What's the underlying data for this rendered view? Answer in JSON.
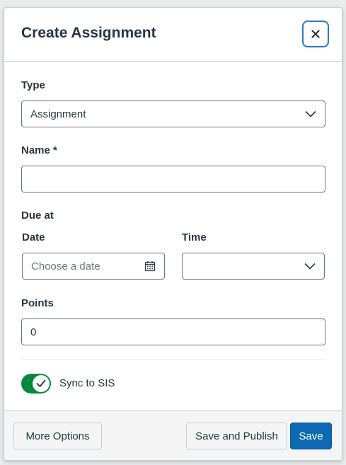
{
  "dialog": {
    "title": "Create Assignment",
    "close_icon": "close-icon"
  },
  "form": {
    "type": {
      "label": "Type",
      "value": "Assignment"
    },
    "name": {
      "label": "Name *",
      "value": ""
    },
    "due": {
      "section_label": "Due at",
      "date_label": "Date",
      "date_placeholder": "Choose a date",
      "time_label": "Time",
      "time_value": ""
    },
    "points": {
      "label": "Points",
      "value": "0"
    },
    "sync": {
      "label": "Sync to SIS",
      "checked": true
    }
  },
  "footer": {
    "more_options": "More Options",
    "save_and_publish": "Save and Publish",
    "save": "Save"
  },
  "colors": {
    "toggle_on": "#03893d",
    "primary_button": "#0e68b3",
    "focus_ring": "#2b7abc"
  }
}
